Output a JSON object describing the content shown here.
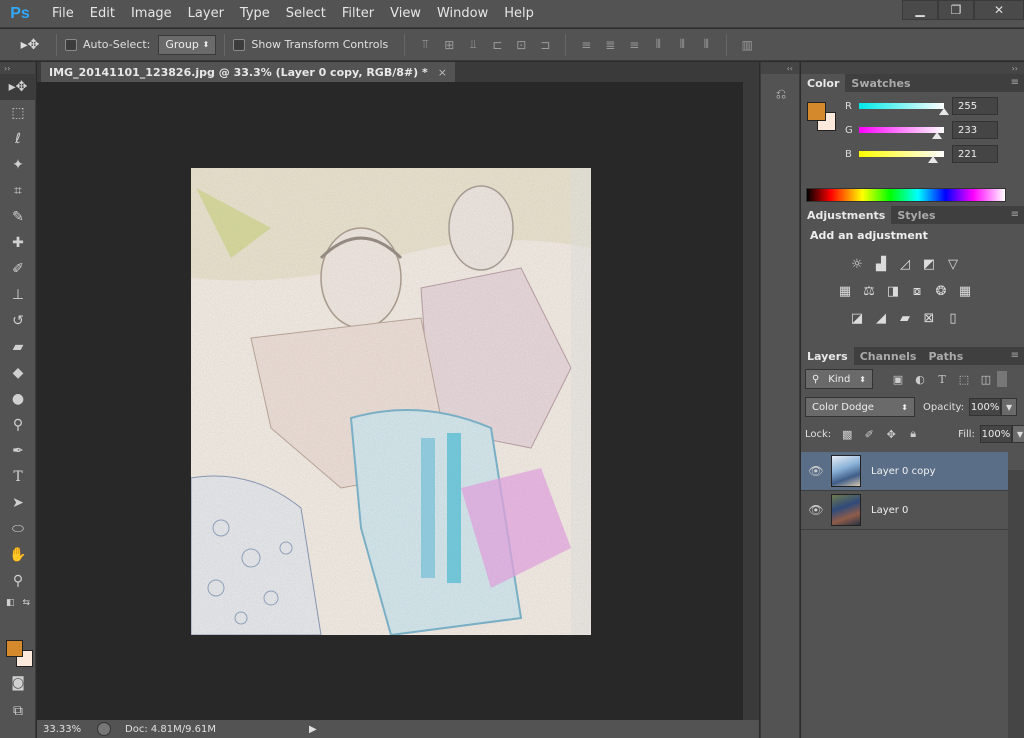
{
  "app": {
    "logo": "Ps",
    "menu": [
      "File",
      "Edit",
      "Image",
      "Layer",
      "Type",
      "Select",
      "Filter",
      "View",
      "Window",
      "Help"
    ],
    "window_controls": {
      "minimize": "▁",
      "restore": "❐",
      "close": "✕"
    }
  },
  "options_bar": {
    "move_tool_icon": "move-tool-icon",
    "auto_select_label": "Auto-Select:",
    "auto_select_target": "Group",
    "show_transform_label": "Show Transform Controls"
  },
  "document": {
    "tab_title": "IMG_20141101_123826.jpg @ 33.3% (Layer 0 copy, RGB/8#) *",
    "close_glyph": "×"
  },
  "status": {
    "zoom": "33.33%",
    "doc_size": "Doc: 4.81M/9.61M",
    "arrow": "▶"
  },
  "colors": {
    "foreground": "#d5892d",
    "background": "#fdeadd",
    "selection": "#5b6e88"
  },
  "color_panel": {
    "tabs": [
      "Color",
      "Swatches"
    ],
    "channels": [
      {
        "label": "R",
        "value": "255",
        "fraction": 1.0,
        "gradient": "linear-gradient(to right,#00e8e8,#ffffff)"
      },
      {
        "label": "G",
        "value": "233",
        "fraction": 0.914,
        "gradient": "linear-gradient(to right,#ff00ff,#ffffff)"
      },
      {
        "label": "B",
        "value": "221",
        "fraction": 0.867,
        "gradient": "linear-gradient(to right,#ffff00,#ffffff)"
      }
    ]
  },
  "adjustments_panel": {
    "tabs": [
      "Adjustments",
      "Styles"
    ],
    "title": "Add an adjustment",
    "rows": [
      [
        "brightness-contrast-icon",
        "levels-icon",
        "curves-icon",
        "exposure-icon",
        "vibrance-icon"
      ],
      [
        "hue-saturation-icon",
        "color-balance-icon",
        "black-white-icon",
        "photo-filter-icon",
        "channel-mixer-icon",
        "color-lookup-icon"
      ],
      [
        "invert-icon",
        "posterize-icon",
        "threshold-icon",
        "selective-color-icon",
        "gradient-map-icon"
      ]
    ]
  },
  "layers_panel": {
    "tabs": [
      "Layers",
      "Channels",
      "Paths"
    ],
    "filter_kind": "Kind",
    "blend_mode": "Color Dodge",
    "opacity_label": "Opacity:",
    "opacity": "100%",
    "lock_label": "Lock:",
    "fill_label": "Fill:",
    "fill": "100%",
    "layers": [
      {
        "name": "Layer 0 copy",
        "selected": true
      },
      {
        "name": "Layer 0",
        "selected": false
      }
    ],
    "footer_icons": [
      "link-icon",
      "fx-icon",
      "mask-icon",
      "adjustment-layer-icon",
      "group-icon",
      "new-layer-icon",
      "trash-icon"
    ]
  }
}
